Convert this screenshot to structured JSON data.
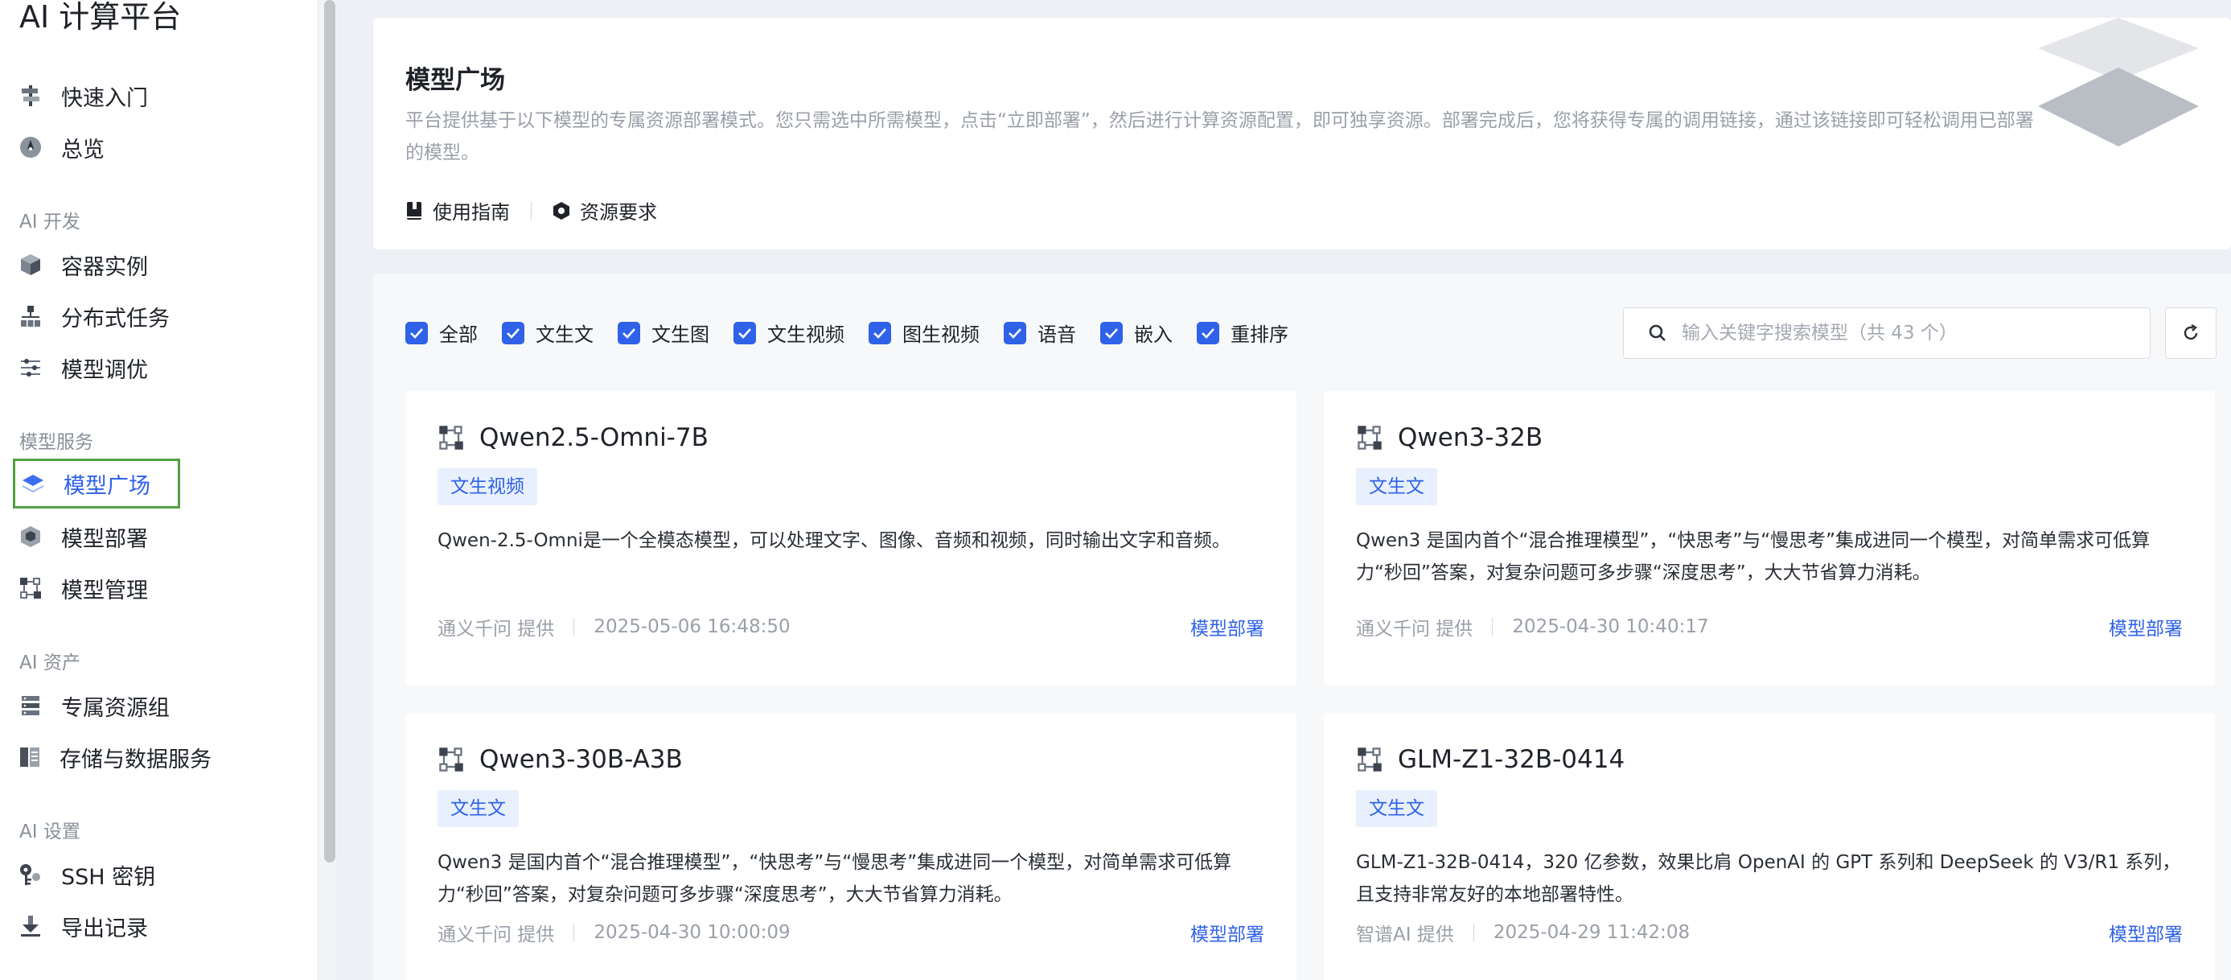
{
  "app": {
    "title": "AI 计算平台"
  },
  "sidebar": {
    "items_top": [
      {
        "label": "快速入门",
        "icon": "signpost-icon"
      },
      {
        "label": "总览",
        "icon": "compass-icon"
      }
    ],
    "sections": [
      {
        "title": "AI 开发",
        "items": [
          {
            "label": "容器实例",
            "icon": "cube-icon"
          },
          {
            "label": "分布式任务",
            "icon": "hierarchy-icon"
          },
          {
            "label": "模型调优",
            "icon": "sliders-icon"
          }
        ]
      },
      {
        "title": "模型服务",
        "items": [
          {
            "label": "模型广场",
            "icon": "layers-icon",
            "active": true
          },
          {
            "label": "模型部署",
            "icon": "model-cube-icon"
          },
          {
            "label": "模型管理",
            "icon": "model-nodes-icon"
          }
        ]
      },
      {
        "title": "AI 资产",
        "items": [
          {
            "label": "专属资源组",
            "icon": "server-icon"
          },
          {
            "label": "存储与数据服务",
            "icon": "storage-icon"
          }
        ]
      },
      {
        "title": "AI 设置",
        "items": [
          {
            "label": "SSH 密钥",
            "icon": "key-icon"
          },
          {
            "label": "导出记录",
            "icon": "download-icon"
          }
        ]
      }
    ]
  },
  "intro": {
    "title": "模型广场",
    "description": "平台提供基于以下模型的专属资源部署模式。您只需选中所需模型，点击“立即部署”，然后进行计算资源配置，即可独享资源。部署完成后，您将获得专属的调用链接，通过该链接即可轻松调用已部署的模型。",
    "links": [
      {
        "label": "使用指南",
        "icon": "book-icon"
      },
      {
        "label": "资源要求",
        "icon": "hexagon-icon"
      }
    ]
  },
  "filters": [
    {
      "label": "全部",
      "checked": true
    },
    {
      "label": "文生文",
      "checked": true
    },
    {
      "label": "文生图",
      "checked": true
    },
    {
      "label": "文生视频",
      "checked": true
    },
    {
      "label": "图生视频",
      "checked": true
    },
    {
      "label": "语音",
      "checked": true
    },
    {
      "label": "嵌入",
      "checked": true
    },
    {
      "label": "重排序",
      "checked": true
    }
  ],
  "search": {
    "placeholder": "输入关键字搜索模型（共 43 个）",
    "value": ""
  },
  "cards": [
    {
      "name": "Qwen2.5-Omni-7B",
      "tag": "文生视频",
      "description": "Qwen-2.5-Omni是一个全模态模型，可以处理文字、图像、音频和视频，同时输出文字和音频。",
      "provider": "通义千问 提供",
      "date": "2025-05-06 16:48:50",
      "action": "模型部署"
    },
    {
      "name": "Qwen3-32B",
      "tag": "文生文",
      "description": "Qwen3 是国内首个“混合推理模型”，“快思考”与“慢思考”集成进同一个模型，对简单需求可低算力“秒回”答案，对复杂问题可多步骤“深度思考”，大大节省算力消耗。",
      "provider": "通义千问 提供",
      "date": "2025-04-30 10:40:17",
      "action": "模型部署"
    },
    {
      "name": "Qwen3-30B-A3B",
      "tag": "文生文",
      "description": "Qwen3 是国内首个“混合推理模型”，“快思考”与“慢思考”集成进同一个模型，对简单需求可低算力“秒回”答案，对复杂问题可多步骤“深度思考”，大大节省算力消耗。",
      "provider": "通义千问 提供",
      "date": "2025-04-30 10:00:09",
      "action": "模型部署"
    },
    {
      "name": "GLM-Z1-32B-0414",
      "tag": "文生文",
      "description": "GLM-Z1-32B-0414，320 亿参数，效果比肩 OpenAI 的 GPT 系列和 DeepSeek 的 V3/R1 系列，且支持非常友好的本地部署特性。",
      "provider": "智谱AI 提供",
      "date": "2025-04-29 11:42:08",
      "action": "模型部署"
    }
  ],
  "colors": {
    "accent": "#2f62e8",
    "active_outline": "#52a043",
    "tag_bg": "#e8f0fd"
  }
}
